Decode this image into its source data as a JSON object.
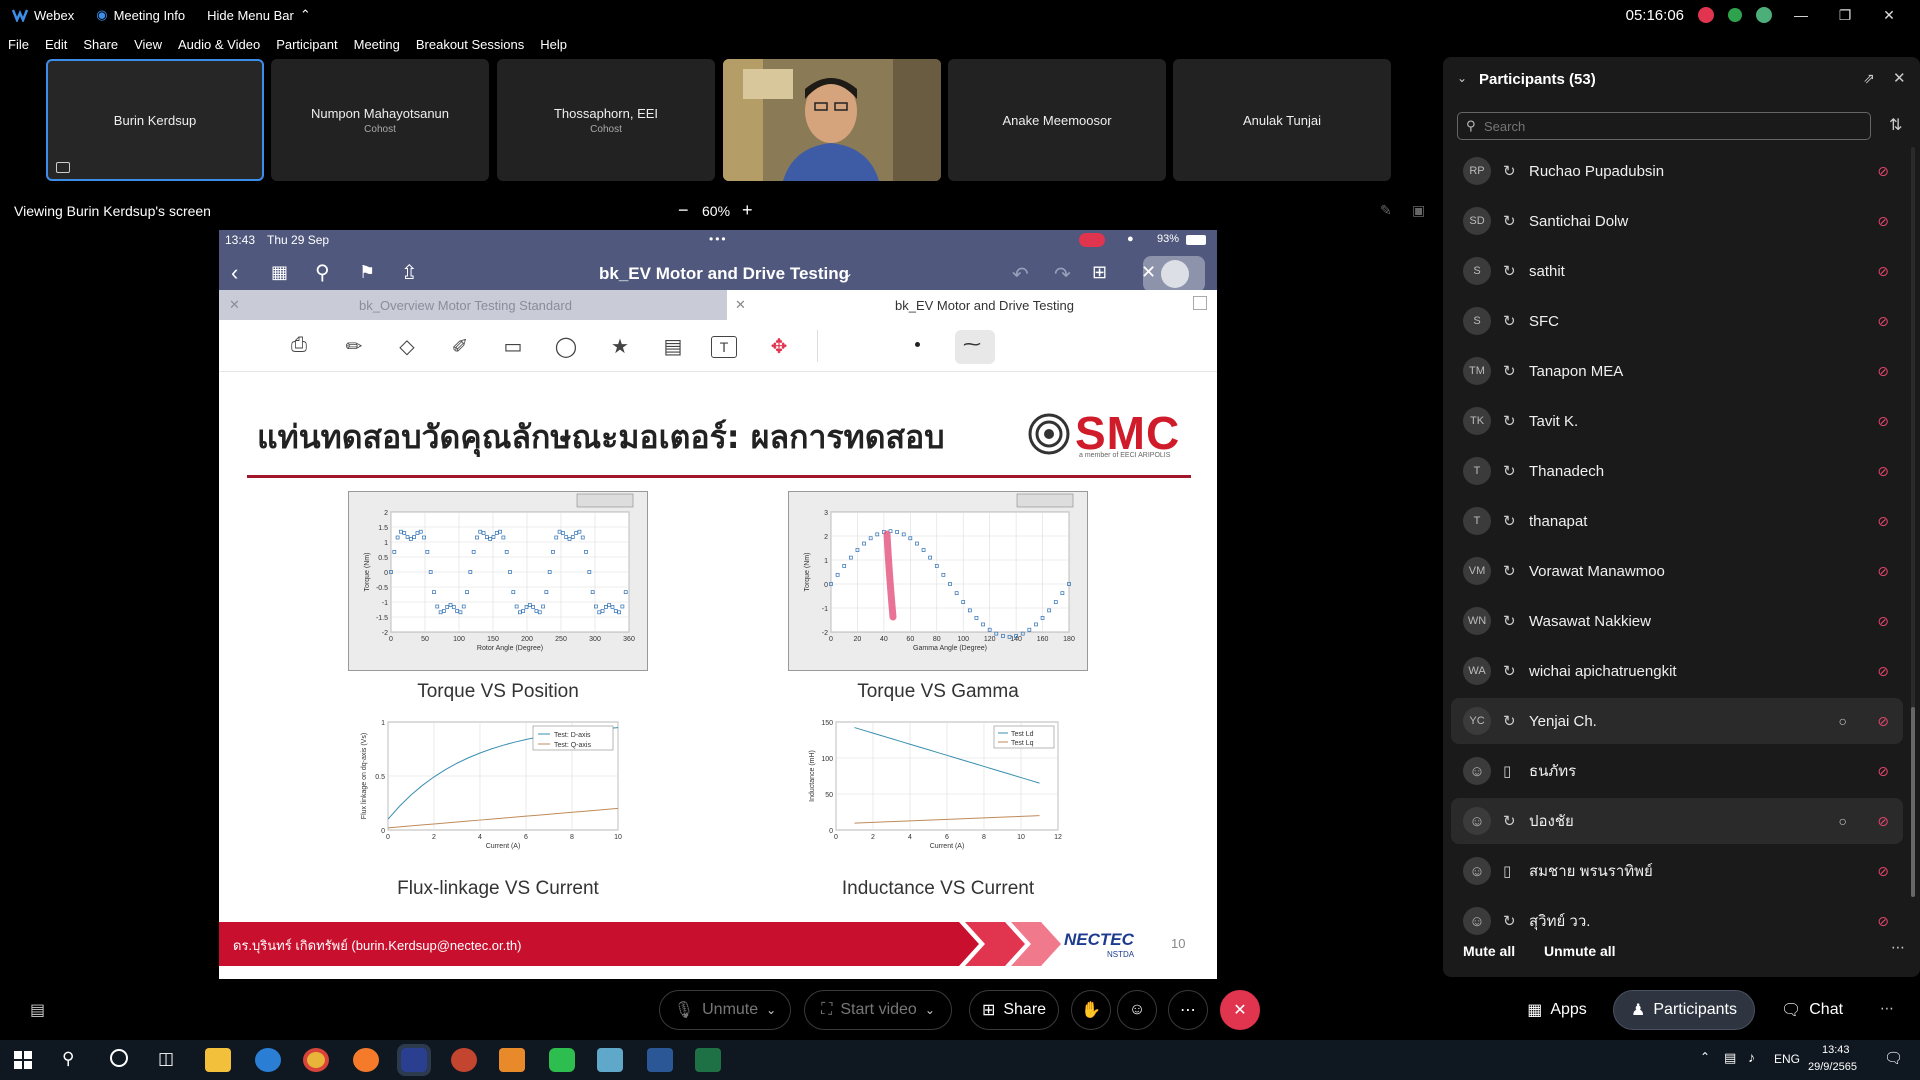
{
  "titlebar": {
    "app": "Webex",
    "meeting_info": "Meeting Info",
    "hide_menu": "Hide Menu Bar",
    "time": "05:16:06"
  },
  "menu": [
    "File",
    "Edit",
    "Share",
    "View",
    "Audio & Video",
    "Participant",
    "Meeting",
    "Breakout Sessions",
    "Help"
  ],
  "tiles": [
    {
      "name": "Burin Kerdsup",
      "sub": ""
    },
    {
      "name": "Numpon Mahayotsanun",
      "sub": "Cohost"
    },
    {
      "name": "Thossaphorn, EEI",
      "sub": "Cohost"
    },
    {
      "name": "",
      "sub": ""
    },
    {
      "name": "Anake Meemoosor",
      "sub": ""
    },
    {
      "name": "Anulak Tunjai",
      "sub": ""
    }
  ],
  "viewing": "Viewing Burin Kerdsup's screen",
  "zoom": "60%",
  "ipad": {
    "time": "13:43",
    "date": "Thu 29 Sep",
    "battery": "93%",
    "doc_title": "bk_EV Motor and Drive Testing",
    "tab1": "bk_Overview Motor Testing Standard",
    "tab2": "bk_EV Motor and Drive Testing"
  },
  "slide": {
    "title": "แท่นทดสอบวัดคุณลักษณะมอเตอร์: ผลการทดสอบ",
    "logo_text": "SMC",
    "logo_tagline": "a member of EECI ARIPOLIS",
    "captions": [
      "Torque VS Position",
      "Torque VS Gamma",
      "Flux-linkage VS Current",
      "Inductance VS Current"
    ],
    "footer": "ดร.บุรินทร์  เกิดทรัพย์ (burin.Kerdsup@nectec.or.th)",
    "footer_logo": "NECTEC",
    "footer_logo_sub": "NSTDA",
    "page": "10",
    "plot1": {
      "ylabel": "Torque (Nm)",
      "xlabel": "Rotor Angle (Degree)",
      "yticks": [
        "2",
        "1.5",
        "1",
        "0.5",
        "0",
        "-0.5",
        "-1",
        "-1.5",
        "-2"
      ],
      "xticks": [
        "0",
        "50",
        "100",
        "150",
        "200",
        "250",
        "300",
        "360"
      ]
    },
    "plot2": {
      "ylabel": "Torque (Nm)",
      "xlabel": "Gamma Angle (Degree)",
      "yticks": [
        "3",
        "2",
        "1",
        "0",
        "-1",
        "-2"
      ],
      "xticks": [
        "0",
        "20",
        "40",
        "60",
        "80",
        "100",
        "120",
        "140",
        "160",
        "180"
      ]
    },
    "plot3": {
      "ylabel": "Flux linkage on dq-axis (Vs)",
      "xlabel": "Current (A)",
      "yticks": [
        "1",
        "0.5",
        "0"
      ],
      "xticks": [
        "0",
        "2",
        "4",
        "6",
        "8",
        "10"
      ],
      "legend": [
        "Test: D-axis",
        "Test: Q-axis"
      ]
    },
    "plot4": {
      "ylabel": "Inductance (mH)",
      "xlabel": "Current (A)",
      "yticks": [
        "150",
        "100",
        "50",
        "0"
      ],
      "xticks": [
        "0",
        "2",
        "4",
        "6",
        "8",
        "10",
        "12"
      ],
      "legend": [
        "Test Ld",
        "Test Lq"
      ]
    }
  },
  "panel": {
    "title": "Participants (53)",
    "search_placeholder": "Search",
    "participants": [
      {
        "initials": "RP",
        "name": "Ruchao Pupadubsin",
        "device": "sync",
        "chat": false
      },
      {
        "initials": "SD",
        "name": "Santichai Dolw",
        "device": "sync",
        "chat": false
      },
      {
        "initials": "S",
        "name": "sathit",
        "device": "sync",
        "chat": false
      },
      {
        "initials": "S",
        "name": "SFC",
        "device": "sync",
        "chat": false
      },
      {
        "initials": "TM",
        "name": "Tanapon MEA",
        "device": "sync",
        "chat": false
      },
      {
        "initials": "TK",
        "name": "Tavit K.",
        "device": "sync",
        "chat": false
      },
      {
        "initials": "T",
        "name": "Thanadech",
        "device": "sync",
        "chat": false
      },
      {
        "initials": "T",
        "name": "thanapat",
        "device": "sync",
        "chat": false
      },
      {
        "initials": "VM",
        "name": "Vorawat Manawmoo",
        "device": "sync",
        "chat": false
      },
      {
        "initials": "WN",
        "name": "Wasawat Nakkiew",
        "device": "sync",
        "chat": false
      },
      {
        "initials": "WA",
        "name": "wichai apichatruengkit",
        "device": "sync",
        "chat": false
      },
      {
        "initials": "YC",
        "name": "Yenjai Ch.",
        "device": "sync",
        "chat": true
      },
      {
        "initials": "",
        "name": "ธนภัทร",
        "device": "phone",
        "chat": false
      },
      {
        "initials": "",
        "name": "ปองชัย",
        "device": "sync",
        "chat": true
      },
      {
        "initials": "",
        "name": "สมชาย พรนราทิพย์",
        "device": "phone",
        "chat": false
      },
      {
        "initials": "",
        "name": "สุวิทย์ วว.",
        "device": "sync",
        "chat": false
      }
    ],
    "mute_all": "Mute all",
    "unmute_all": "Unmute all"
  },
  "controls": {
    "unmute": "Unmute",
    "start_video": "Start video",
    "share": "Share",
    "apps": "Apps",
    "participants": "Participants",
    "chat": "Chat"
  },
  "taskbar": {
    "lang": "ENG",
    "time": "13:43",
    "date": "29/9/2565"
  }
}
